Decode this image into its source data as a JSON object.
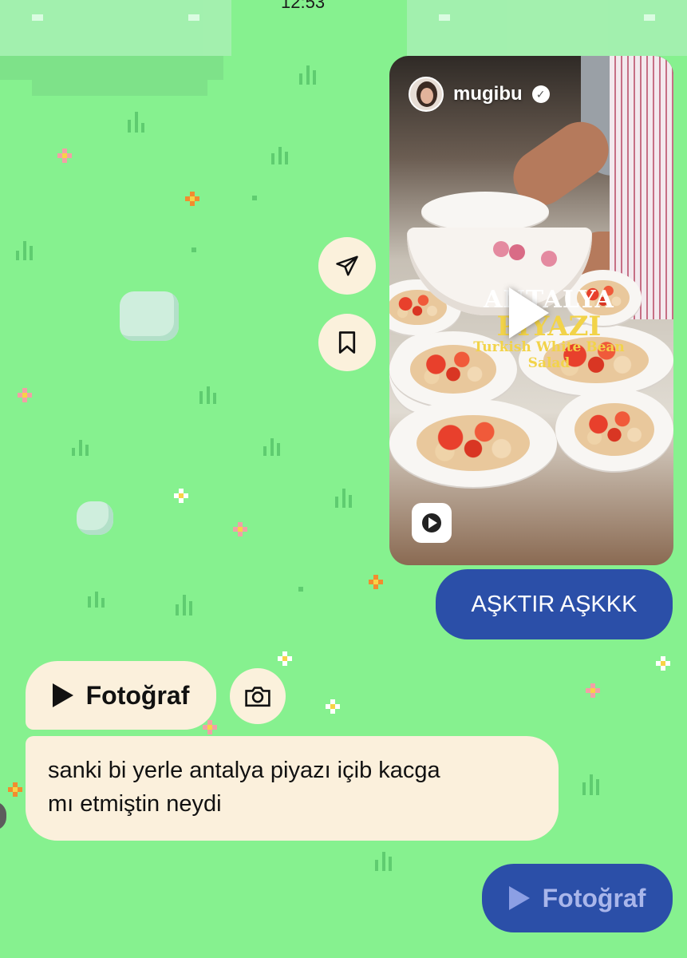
{
  "status_bar": {
    "time": "12:53"
  },
  "reel": {
    "username": "mugibu",
    "verified_icon": "verified-badge-icon",
    "title_line1": "ANTALYA",
    "title_line2": "PİYAZI",
    "title_line3": "Turkish White Bean Salad",
    "play_icon": "play-icon",
    "reel_icon": "reels-icon"
  },
  "actions": {
    "share_icon": "send-icon",
    "save_icon": "bookmark-icon"
  },
  "messages": [
    {
      "from": "me",
      "type": "text",
      "text": "AŞKTIR AŞKKK"
    },
    {
      "from": "them",
      "type": "photo",
      "label": "Fotoğraf"
    },
    {
      "from": "them",
      "type": "text",
      "line1": "sanki bi yerle antalya piyazı içib kacga",
      "line2": "mı etmiştin neydi"
    },
    {
      "from": "me",
      "type": "photo",
      "label": "Fotoğraf"
    }
  ],
  "colors": {
    "background": "#86f18f",
    "outgoing_bubble": "#2b4fa8",
    "incoming_bubble": "#fbf0dc"
  }
}
